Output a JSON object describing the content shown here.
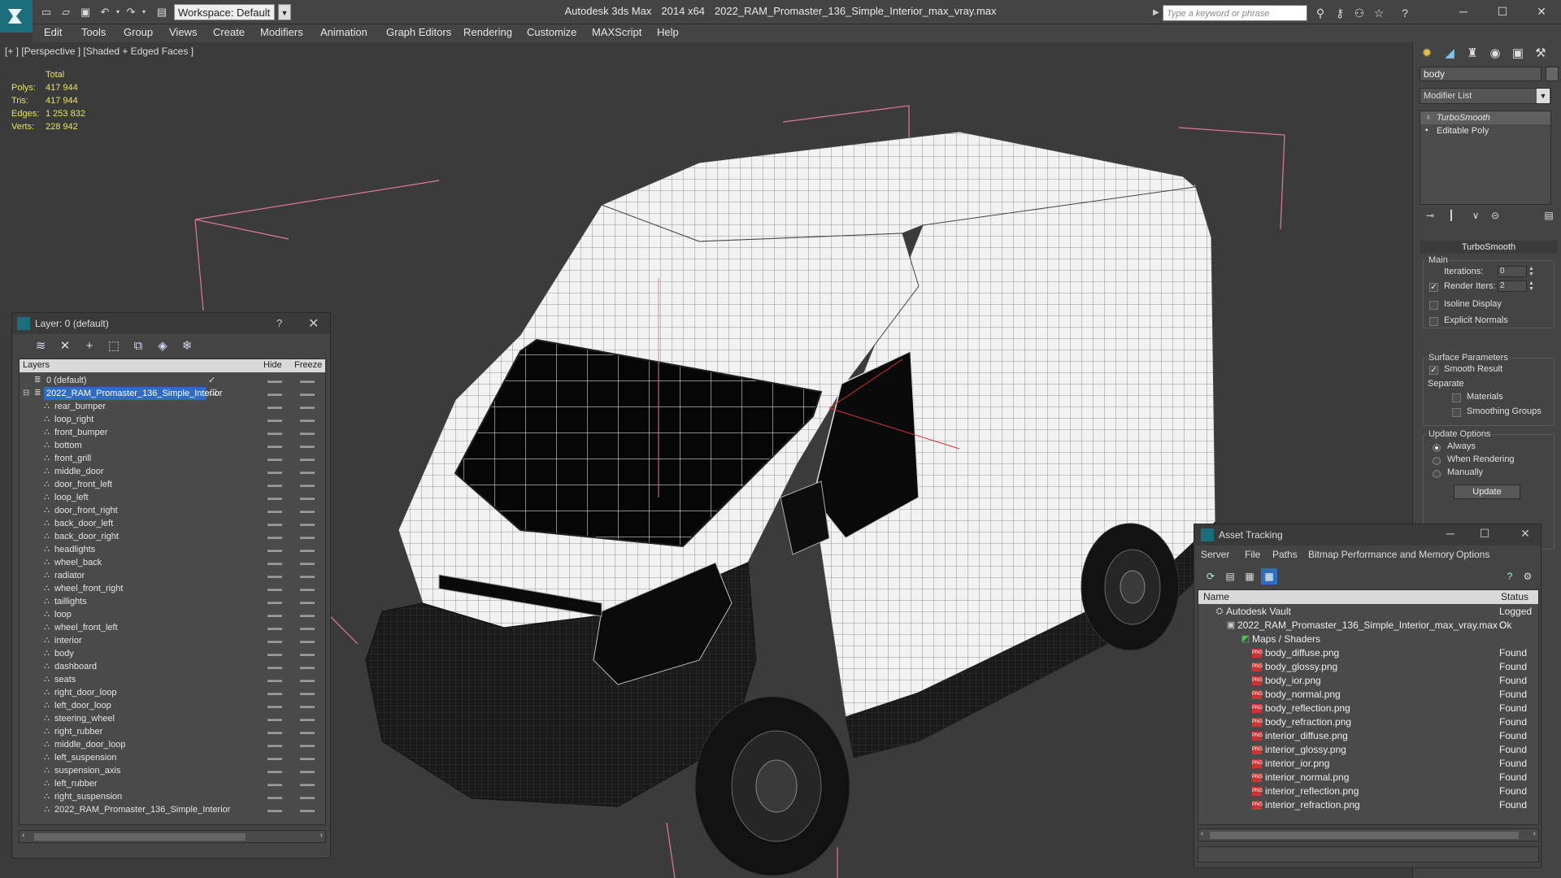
{
  "titlebar": {
    "app_name": "Autodesk 3ds Max",
    "version": "2014 x64",
    "file_name": "2022_RAM_Promaster_136_Simple_Interior_max_vray.max",
    "workspace": "Workspace: Default",
    "search_placeholder": "Type a keyword or phrase"
  },
  "menu": [
    "Edit",
    "Tools",
    "Group",
    "Views",
    "Create",
    "Modifiers",
    "Animation",
    "Graph Editors",
    "Rendering",
    "Customize",
    "MAXScript",
    "Help"
  ],
  "viewport": {
    "label": "[+ ] [Perspective ] [Shaded + Edged Faces ]",
    "stats": {
      "header": "Total",
      "rows": [
        {
          "k": "Polys:",
          "v": "417 944"
        },
        {
          "k": "Tris:",
          "v": "417 944"
        },
        {
          "k": "Edges:",
          "v": "1 253 832"
        },
        {
          "k": "Verts:",
          "v": "228 942"
        }
      ]
    }
  },
  "command_panel": {
    "object_name": "body",
    "modifier_list": "Modifier List",
    "stack": [
      "TurboSmooth",
      "Editable Poly"
    ],
    "rollout": "TurboSmooth",
    "main_group": "Main",
    "iterations_label": "Iterations:",
    "iterations_value": "0",
    "render_iters_label": "Render Iters:",
    "render_iters_value": "2",
    "isoline_display": "Isoline Display",
    "explicit_normals": "Explicit Normals",
    "surface_group": "Surface Parameters",
    "smooth_result": "Smooth Result",
    "separate": "Separate",
    "materials": "Materials",
    "smoothing_groups": "Smoothing Groups",
    "update_group": "Update Options",
    "always": "Always",
    "when_rendering": "When Rendering",
    "manually": "Manually",
    "update_button": "Update"
  },
  "layer_panel": {
    "title": "Layer: 0 (default)",
    "help": "?",
    "columns": {
      "layers": "Layers",
      "hide": "Hide",
      "freeze": "Freeze"
    },
    "layers": [
      "0 (default)",
      "2022_RAM_Promaster_136_Simple_Interior"
    ],
    "objects": [
      "rear_bumper",
      "loop_right",
      "front_bumper",
      "bottom",
      "front_grill",
      "middle_door",
      "door_front_left",
      "loop_left",
      "door_front_right",
      "back_door_left",
      "back_door_right",
      "headlights",
      "wheel_back",
      "radiator",
      "wheel_front_right",
      "taillights",
      "loop",
      "wheel_front_left",
      "interior",
      "body",
      "dashboard",
      "seats",
      "right_door_loop",
      "left_door_loop",
      "steering_wheel",
      "right_rubber",
      "middle_door_loop",
      "left_suspension",
      "suspension_axis",
      "left_rubber",
      "right_suspension",
      "2022_RAM_Promaster_136_Simple_Interior"
    ]
  },
  "asset_panel": {
    "title": "Asset Tracking",
    "menu": [
      "Server",
      "File",
      "Paths",
      "Bitmap Performance and Memory",
      "Options"
    ],
    "columns": {
      "name": "Name",
      "status": "Status"
    },
    "vault": {
      "name": "Autodesk Vault",
      "status": "Logged O"
    },
    "scene_file": {
      "name": "2022_RAM_Promaster_136_Simple_Interior_max_vray.max",
      "status": "Ok"
    },
    "maps_group": "Maps / Shaders",
    "maps": [
      {
        "name": "body_diffuse.png",
        "status": "Found"
      },
      {
        "name": "body_glossy.png",
        "status": "Found"
      },
      {
        "name": "body_ior.png",
        "status": "Found"
      },
      {
        "name": "body_normal.png",
        "status": "Found"
      },
      {
        "name": "body_reflection.png",
        "status": "Found"
      },
      {
        "name": "body_refraction.png",
        "status": "Found"
      },
      {
        "name": "interior_diffuse.png",
        "status": "Found"
      },
      {
        "name": "interior_glossy.png",
        "status": "Found"
      },
      {
        "name": "interior_ior.png",
        "status": "Found"
      },
      {
        "name": "interior_normal.png",
        "status": "Found"
      },
      {
        "name": "interior_reflection.png",
        "status": "Found"
      },
      {
        "name": "interior_refraction.png",
        "status": "Found"
      }
    ]
  },
  "colors": {
    "brand_teal": "#1b6e7b",
    "selection_blue": "#2f6cc6",
    "stats_yellow": "#e8e06a",
    "bbox_pink": "#e07a9a"
  }
}
